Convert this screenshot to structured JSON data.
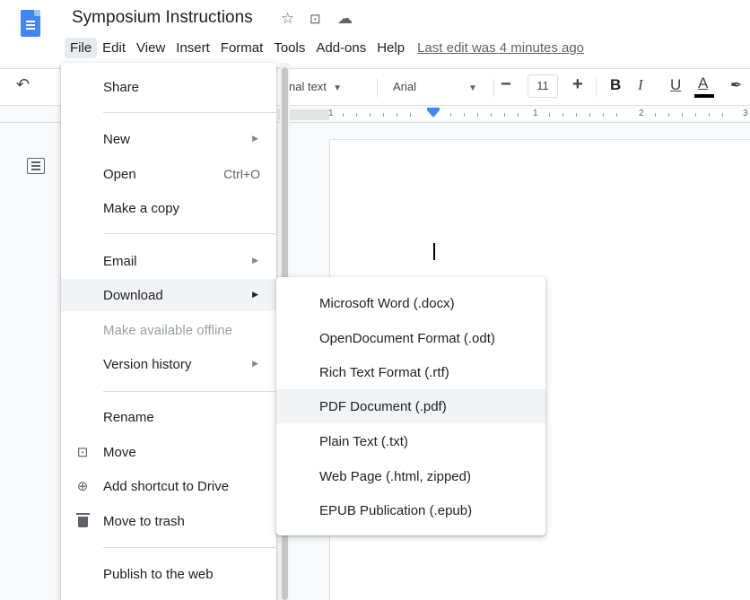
{
  "app": {
    "doc_title": "Symposium Instructions",
    "star_icon": "star-icon",
    "move_icon": "move-to-folder-icon",
    "cloud_icon": "cloud-status-icon"
  },
  "menubar": {
    "items": [
      "File",
      "Edit",
      "View",
      "Insert",
      "Format",
      "Tools",
      "Add-ons",
      "Help"
    ],
    "active": "File",
    "last_edit": "Last edit was 4 minutes ago"
  },
  "toolbar": {
    "style_value": "nal text",
    "font_value": "Arial",
    "font_size": "11",
    "bold": "B",
    "italic": "I",
    "underline": "U",
    "text_color": "A"
  },
  "ruler": {
    "labels": [
      "1",
      "1",
      "2",
      "3"
    ]
  },
  "file_menu": {
    "items": [
      {
        "label": "Share"
      },
      {
        "label": "New"
      },
      {
        "label": "Open",
        "shortcut": "Ctrl+O"
      },
      {
        "label": "Make a copy"
      },
      {
        "label": "Email"
      },
      {
        "label": "Download",
        "highlighted": true
      },
      {
        "label": "Make available offline",
        "disabled": true
      },
      {
        "label": "Version history"
      },
      {
        "label": "Rename"
      },
      {
        "label": "Move",
        "icon": "move-icon"
      },
      {
        "label": "Add shortcut to Drive",
        "icon": "add-shortcut-icon"
      },
      {
        "label": "Move to trash",
        "icon": "trash-icon"
      },
      {
        "label": "Publish to the web"
      }
    ]
  },
  "download_menu": {
    "items": [
      {
        "label": "Microsoft Word (.docx)"
      },
      {
        "label": "OpenDocument Format (.odt)"
      },
      {
        "label": "Rich Text Format (.rtf)"
      },
      {
        "label": "PDF Document (.pdf)",
        "highlighted": true
      },
      {
        "label": "Plain Text (.txt)"
      },
      {
        "label": "Web Page (.html, zipped)"
      },
      {
        "label": "EPUB Publication (.epub)"
      }
    ]
  },
  "colors": {
    "accent": "#4285f4",
    "highlight": "#f1f3f4"
  }
}
